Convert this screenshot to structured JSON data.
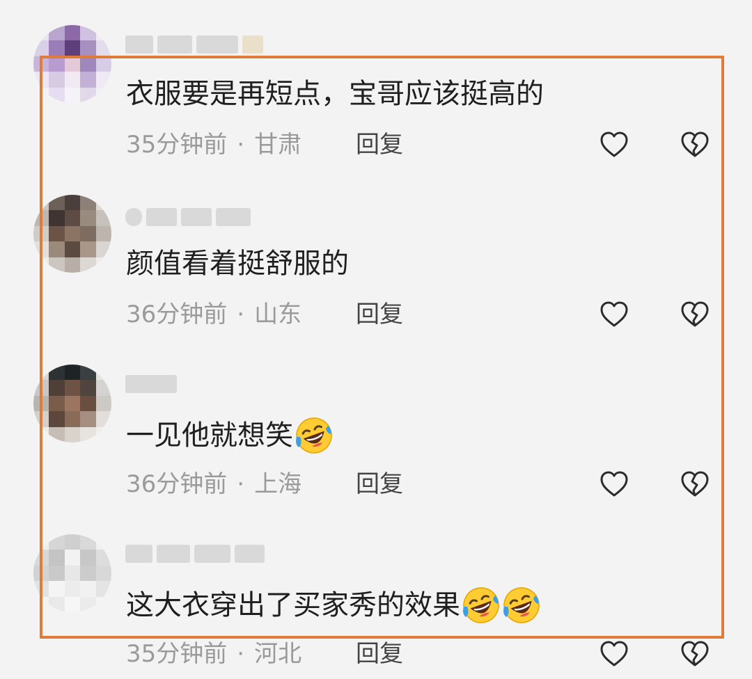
{
  "comments": [
    {
      "text": "衣服要是再短点，宝哥应该挺高的",
      "time": "35分钟前",
      "dot": "·",
      "location": "甘肃",
      "reply_label": "回复",
      "emoji_count": 0
    },
    {
      "text": "颜值看着挺舒服的",
      "time": "36分钟前",
      "dot": "·",
      "location": "山东",
      "reply_label": "回复",
      "emoji_count": 0
    },
    {
      "text": "一见他就想笑",
      "time": "36分钟前",
      "dot": "·",
      "location": "上海",
      "reply_label": "回复",
      "emoji_count": 1
    },
    {
      "text": "这大衣穿出了买家秀的效果",
      "time": "35分钟前",
      "dot": "·",
      "location": "河北",
      "reply_label": "回复",
      "emoji_count": 2
    }
  ],
  "icons": {
    "like": "heart-outline-icon",
    "dislike": "broken-heart-icon",
    "emoji": "rolling-on-floor-laughing-emoji"
  },
  "colors": {
    "highlight_frame": "#e07c3a",
    "meta_text": "#9a9a9a",
    "comment_text": "#1f1f1f"
  }
}
